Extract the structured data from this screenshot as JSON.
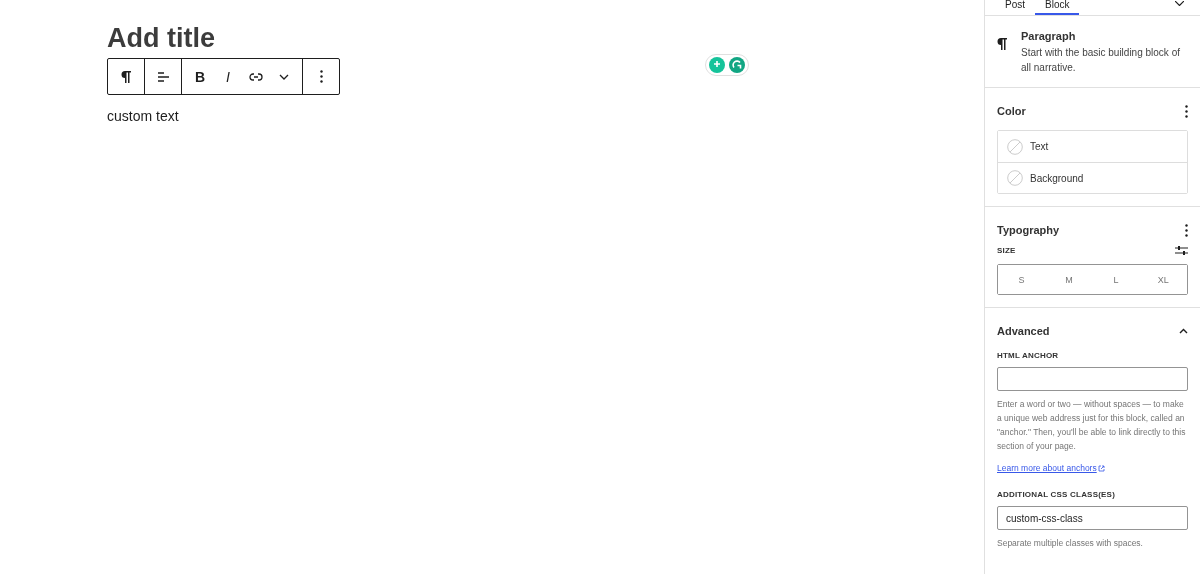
{
  "editor": {
    "title_placeholder": "Add title",
    "paragraph": "custom text",
    "toolbar": {
      "groups": [
        [
          {
            "kind": "paragraph"
          }
        ],
        [
          {
            "kind": "align"
          }
        ],
        [
          {
            "kind": "bold",
            "label": "B"
          },
          {
            "kind": "italic",
            "label": "I"
          },
          {
            "kind": "link"
          },
          {
            "kind": "more"
          }
        ],
        [
          {
            "kind": "options"
          }
        ]
      ]
    }
  },
  "sidebar": {
    "tabs": [
      {
        "label": "Post",
        "selected": false
      },
      {
        "label": "Block",
        "selected": true
      }
    ],
    "block_card": {
      "title": "Paragraph",
      "description": "Start with the basic building block of all narrative."
    },
    "color": {
      "title": "Color",
      "items": [
        {
          "label": "Text"
        },
        {
          "label": "Background"
        }
      ]
    },
    "typography": {
      "title": "Typography",
      "size_label": "SIZE",
      "sizes": [
        {
          "label": "S",
          "selected": false
        },
        {
          "label": "M",
          "selected": false
        },
        {
          "label": "L",
          "selected": false
        },
        {
          "label": "XL",
          "selected": false
        }
      ]
    },
    "advanced": {
      "title": "Advanced",
      "expanded": true,
      "anchor_label": "HTML ANCHOR",
      "anchor_help": "Enter a word or two — without spaces — to make a unique web address just for this block, called an \"anchor.\" Then, you'll be able to link directly to this section of your page.",
      "learn_more": "Learn more about anchors",
      "css_label": "ADDITIONAL CSS CLASS(ES)",
      "css_value": "custom-css-class",
      "css_help": "Separate multiple classes with spaces."
    }
  }
}
